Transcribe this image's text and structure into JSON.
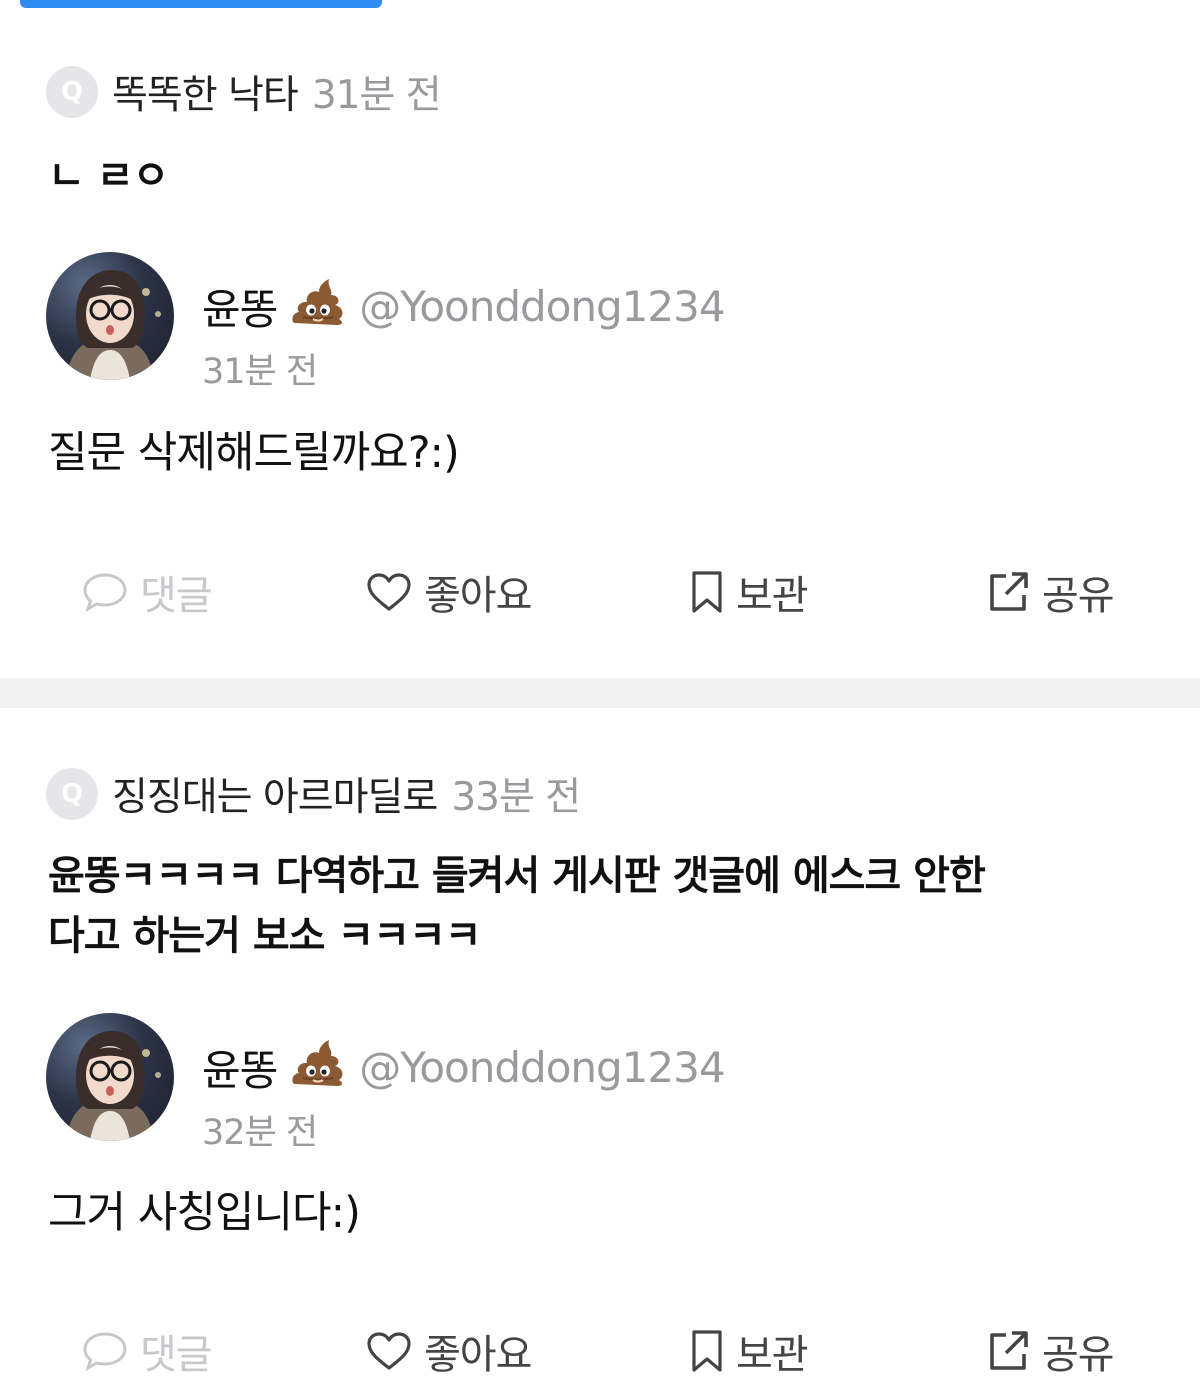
{
  "posts": [
    {
      "asker": "똑똑한 낙타",
      "q_time": "31분 전",
      "question": "ㄴ ㄹㅇ",
      "answerer_name": "윤똥",
      "answerer_handle": "@Yoonddong1234",
      "a_time": "31분 전",
      "answer": "질문 삭제해드릴까요?:)",
      "actions": {
        "comment": "댓글",
        "like": "좋아요",
        "save": "보관",
        "share": "공유"
      }
    },
    {
      "asker": "징징대는 아르마딜로",
      "q_time": "33분 전",
      "question_line1": "윤똥ㅋㅋㅋㅋ 다역하고 들켜서 게시판 갯글에 에스크 안한",
      "question_line2": "다고 하는거 보소 ㅋㅋㅋㅋ",
      "answerer_name": "윤똥",
      "answerer_handle": "@Yoonddong1234",
      "a_time": "32분 전",
      "answer": "그거 사칭입니다:)",
      "actions": {
        "comment": "댓글",
        "like": "좋아요",
        "save": "보관",
        "share": "공유"
      }
    }
  ],
  "badge_letter": "Q",
  "emoji": "💩",
  "colors": {
    "accent": "#2f8cf0",
    "muted": "#9a9a9e",
    "disabled": "#c8c8cc",
    "divider": "#f2f2f3"
  }
}
